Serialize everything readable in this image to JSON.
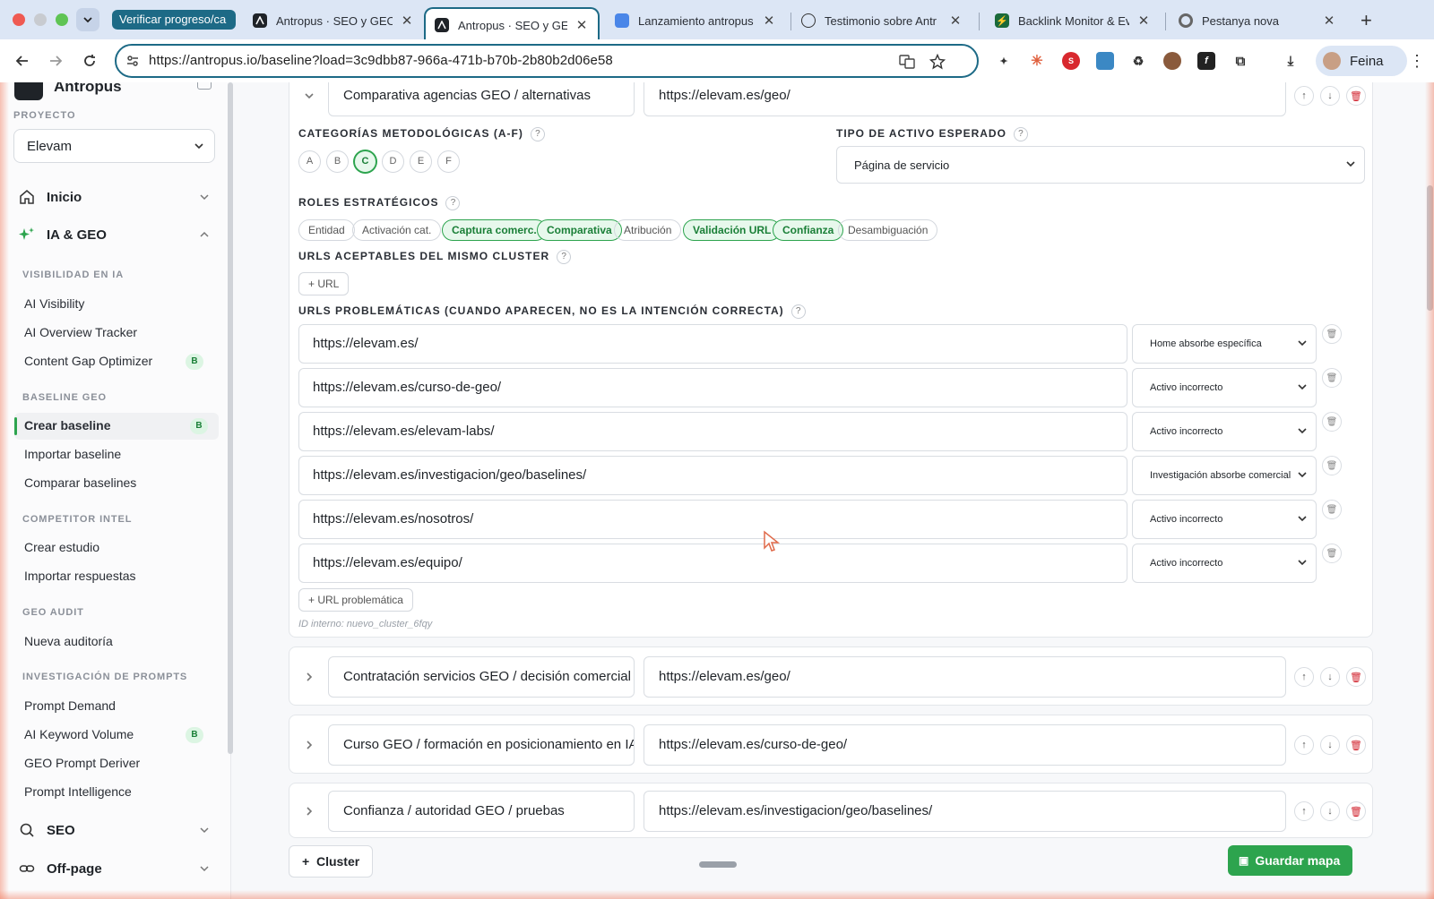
{
  "browser": {
    "group_chip": "Verificar progreso/ca",
    "tabs": [
      {
        "title": "Antropus · SEO y GEO",
        "active": false
      },
      {
        "title": "Antropus · SEO y GEO",
        "active": true
      },
      {
        "title": "Lanzamiento antropus",
        "active": false
      },
      {
        "title": "Testimonio sobre Antr",
        "active": false
      },
      {
        "title": "Backlink Monitor & Ev",
        "active": false
      },
      {
        "title": "Pestanya nova",
        "active": false
      }
    ],
    "url": "https://antropus.io/baseline?load=3c9dbb87-966a-471b-b70b-2b80b2d06e58",
    "profile_label": "Feina"
  },
  "sidebar": {
    "brand": "Antropus",
    "project_label": "PROYECTO",
    "project_value": "Elevam",
    "main": [
      {
        "label": "Inicio",
        "icon": "home-icon"
      },
      {
        "label": "IA & GEO",
        "icon": "sparkle-icon"
      },
      {
        "label": "SEO",
        "icon": "search-icon"
      },
      {
        "label": "Off-page",
        "icon": "link-icon"
      }
    ],
    "sections": [
      {
        "title": "VISIBILIDAD EN IA",
        "items": [
          {
            "label": "AI Visibility",
            "badge": ""
          },
          {
            "label": "AI Overview Tracker",
            "badge": ""
          },
          {
            "label": "Content Gap Optimizer",
            "badge": "B"
          }
        ]
      },
      {
        "title": "BASELINE GEO",
        "items": [
          {
            "label": "Crear baseline",
            "badge": "B"
          },
          {
            "label": "Importar baseline",
            "badge": ""
          },
          {
            "label": "Comparar baselines",
            "badge": ""
          }
        ]
      },
      {
        "title": "COMPETITOR INTEL",
        "items": [
          {
            "label": "Crear estudio",
            "badge": ""
          },
          {
            "label": "Importar respuestas",
            "badge": ""
          }
        ]
      },
      {
        "title": "GEO AUDIT",
        "items": [
          {
            "label": "Nueva auditoría",
            "badge": ""
          }
        ]
      },
      {
        "title": "INVESTIGACIÓN DE PROMPTS",
        "items": [
          {
            "label": "Prompt Demand",
            "badge": ""
          },
          {
            "label": "AI Keyword Volume",
            "badge": "B"
          },
          {
            "label": "GEO Prompt Deriver",
            "badge": ""
          },
          {
            "label": "Prompt Intelligence",
            "badge": ""
          }
        ]
      }
    ]
  },
  "cluster_open": {
    "name": "Comparativa agencias GEO / alternativas",
    "url": "https://elevam.es/geo/",
    "categories_label": "CATEGORÍAS METODOLÓGICAS (A-F)",
    "categories": [
      {
        "letter": "A",
        "on": false
      },
      {
        "letter": "B",
        "on": false
      },
      {
        "letter": "C",
        "on": true
      },
      {
        "letter": "D",
        "on": false
      },
      {
        "letter": "E",
        "on": false
      },
      {
        "letter": "F",
        "on": false
      }
    ],
    "asset_label": "TIPO DE ACTIVO ESPERADO",
    "asset_value": "Página de servicio",
    "roles_label": "ROLES ESTRATÉGICOS",
    "roles": [
      {
        "label": "Entidad",
        "on": false
      },
      {
        "label": "Activación cat.",
        "on": false
      },
      {
        "label": "Captura comerc.",
        "on": true
      },
      {
        "label": "Comparativa",
        "on": true
      },
      {
        "label": "Atribución",
        "on": false
      },
      {
        "label": "Validación URL",
        "on": true
      },
      {
        "label": "Confianza",
        "on": true
      },
      {
        "label": "Desambiguación",
        "on": false
      }
    ],
    "acceptable_label": "URLS ACEPTABLES DEL MISMO CLUSTER",
    "add_url_label": "URL",
    "problematic_label": "URLS PROBLEMÁTICAS (CUANDO APARECEN, NO ES LA INTENCIÓN CORRECTA)",
    "problematic": [
      {
        "url": "https://elevam.es/",
        "reason": "Home absorbe específica"
      },
      {
        "url": "https://elevam.es/curso-de-geo/",
        "reason": "Activo incorrecto"
      },
      {
        "url": "https://elevam.es/elevam-labs/",
        "reason": "Activo incorrecto"
      },
      {
        "url": "https://elevam.es/investigacion/geo/baselines/",
        "reason": "Investigación absorbe comercial"
      },
      {
        "url": "https://elevam.es/nosotros/",
        "reason": "Activo incorrecto"
      },
      {
        "url": "https://elevam.es/equipo/",
        "reason": "Activo incorrecto"
      }
    ],
    "add_problematic_label": "URL problemática",
    "internal_id": "ID interno: nuevo_cluster_6fqy"
  },
  "clusters_collapsed": [
    {
      "name": "Contratación servicios GEO / decisión comercial",
      "url": "https://elevam.es/geo/"
    },
    {
      "name": "Curso GEO / formación en posicionamiento en IA",
      "url": "https://elevam.es/curso-de-geo/"
    },
    {
      "name": "Confianza / autoridad GEO / pruebas",
      "url": "https://elevam.es/investigacion/geo/baselines/"
    }
  ],
  "footer": {
    "add_cluster_label": "Cluster",
    "save_label": "Guardar mapa"
  },
  "colors": {
    "accent": "#2da44e",
    "chrome_accent": "#1d6a86"
  }
}
